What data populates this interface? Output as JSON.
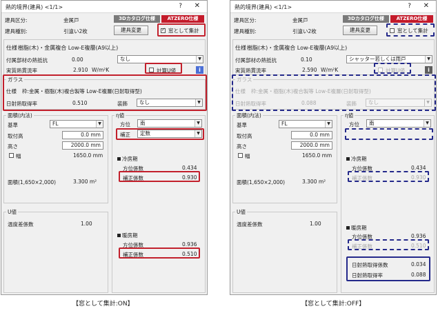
{
  "window": {
    "title": "熱的境界(建具) <1/1>",
    "help": "?",
    "close": "✕"
  },
  "tabs": {
    "catalog": "3Dカタログ仕様",
    "atzero": "ATZERO仕様"
  },
  "header": {
    "kubun_label": "建具区分:",
    "kubun_value": "金属戸",
    "shubetsu_label": "建具種別:",
    "shubetsu_value": "引違い2枚",
    "change_button": "建具変更",
    "window_count_label": "窓として集計"
  },
  "spec": {
    "label": "仕様",
    "value": "樹脂(木)・金属複合 Low-E複層(A9以上)",
    "fuzoku_label": "付属部材の熱抵抗",
    "jikko_label": "実質熱貫流率",
    "jikko_unit": "W/m²K",
    "ucalc_label": "計算U値"
  },
  "glass": {
    "group": "ガラス",
    "label": "仕様",
    "value": "枠:金属・樹脂(木)複合製等 Low-E複層(日射取得型)",
    "solar_label": "日射熱取得率",
    "solar_value": "0.510",
    "accessory_label": "装飾",
    "accessory_value": "なし"
  },
  "area": {
    "group": "面積(内法)",
    "base_label": "基準",
    "base_value": "FL",
    "mount_label": "取付高",
    "mount_value": "0.0 mm",
    "height_label": "高さ",
    "height_value": "2000.0 mm",
    "width_label": "幅",
    "width_value": "1650.0 mm",
    "area_label": "面積(1,650×2,000)",
    "area_value": "3.300 m²"
  },
  "uvalue": {
    "group": "U値",
    "temp_label": "温度差係数",
    "temp_value": "1.00"
  },
  "eta": {
    "group": "η値",
    "direction_label": "方位",
    "direction_value": "南",
    "correction_label": "補正",
    "correction_value": "定数",
    "cooling_title": "冷房期",
    "cooling_dir_label": "方位係数",
    "cooling_dir_value": "0.434",
    "cooling_corr_label": "補正係数",
    "cooling_corr_value": "0.930",
    "heating_title": "暖房期",
    "heating_dir_label": "方位係数",
    "heating_dir_value": "0.936",
    "heating_corr_label": "補正係数",
    "heating_corr_value": "0.510",
    "solar_coef_label": "日射熱取得係数",
    "solar_coef_value": "0.034",
    "solar_rate_label": "日射熱取得率",
    "solar_rate_value": "0.088"
  },
  "left": {
    "fuzoku_value": "0.00",
    "fuzoku_select": "なし",
    "jikko_value": "2.910",
    "caption": "【窓として集計:ON】"
  },
  "right": {
    "fuzoku_value": "0.10",
    "fuzoku_select": "シャッター若しくは雨戸",
    "jikko_value": "2.590",
    "glass_solar_value": "0.088",
    "caption": "【窓として集計:OFF】"
  },
  "colors": {
    "highlight_red": "#c21f2b",
    "highlight_navy": "#23288a",
    "atzero_tab": "#c41a2a"
  }
}
